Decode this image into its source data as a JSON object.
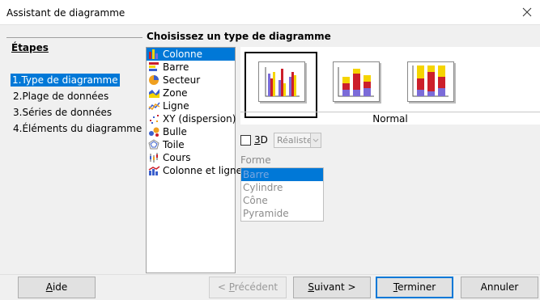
{
  "window": {
    "title": "Assistant de diagramme"
  },
  "steps": {
    "heading": "Étapes",
    "items": [
      {
        "label": "1.Type de diagramme",
        "selected": true
      },
      {
        "label": "2.Plage de données"
      },
      {
        "label": "3.Séries de données"
      },
      {
        "label": "4.Éléments du diagramme"
      }
    ]
  },
  "main": {
    "title": "Choisissez un type de diagramme",
    "types": [
      {
        "label": "Colonne",
        "icon": "column-chart-icon",
        "selected": true
      },
      {
        "label": "Barre",
        "icon": "bar-chart-icon"
      },
      {
        "label": "Secteur",
        "icon": "pie-chart-icon"
      },
      {
        "label": "Zone",
        "icon": "area-chart-icon"
      },
      {
        "label": "Ligne",
        "icon": "line-chart-icon"
      },
      {
        "label": "XY (dispersion)",
        "icon": "scatter-chart-icon"
      },
      {
        "label": "Bulle",
        "icon": "bubble-chart-icon"
      },
      {
        "label": "Toile",
        "icon": "net-chart-icon"
      },
      {
        "label": "Cours",
        "icon": "stock-chart-icon"
      },
      {
        "label": "Colonne et ligne",
        "icon": "column-line-chart-icon"
      }
    ],
    "variant_name": "Normal",
    "three_d": {
      "label_prefix": "",
      "label_accel": "3",
      "label_rest": "D",
      "checked": false,
      "style_value": "Réaliste"
    },
    "shape": {
      "label": "Forme",
      "options": [
        {
          "label": "Barre",
          "selected": true
        },
        {
          "label": "Cylindre"
        },
        {
          "label": "Cône"
        },
        {
          "label": "Pyramide"
        }
      ]
    }
  },
  "buttons": {
    "help": {
      "accel": "A",
      "rest": "ide"
    },
    "previous": {
      "prefix": "< ",
      "accel": "P",
      "rest": "récédent"
    },
    "next": {
      "accel": "S",
      "rest": "uivant >"
    },
    "finish": {
      "accel": "T",
      "rest": "erminer"
    },
    "cancel": "Annuler"
  },
  "colors": {
    "selection": "#0078d7",
    "bar_blue": "#7b6bd8",
    "bar_red": "#cc1f2b",
    "bar_yellow": "#f5d400"
  }
}
